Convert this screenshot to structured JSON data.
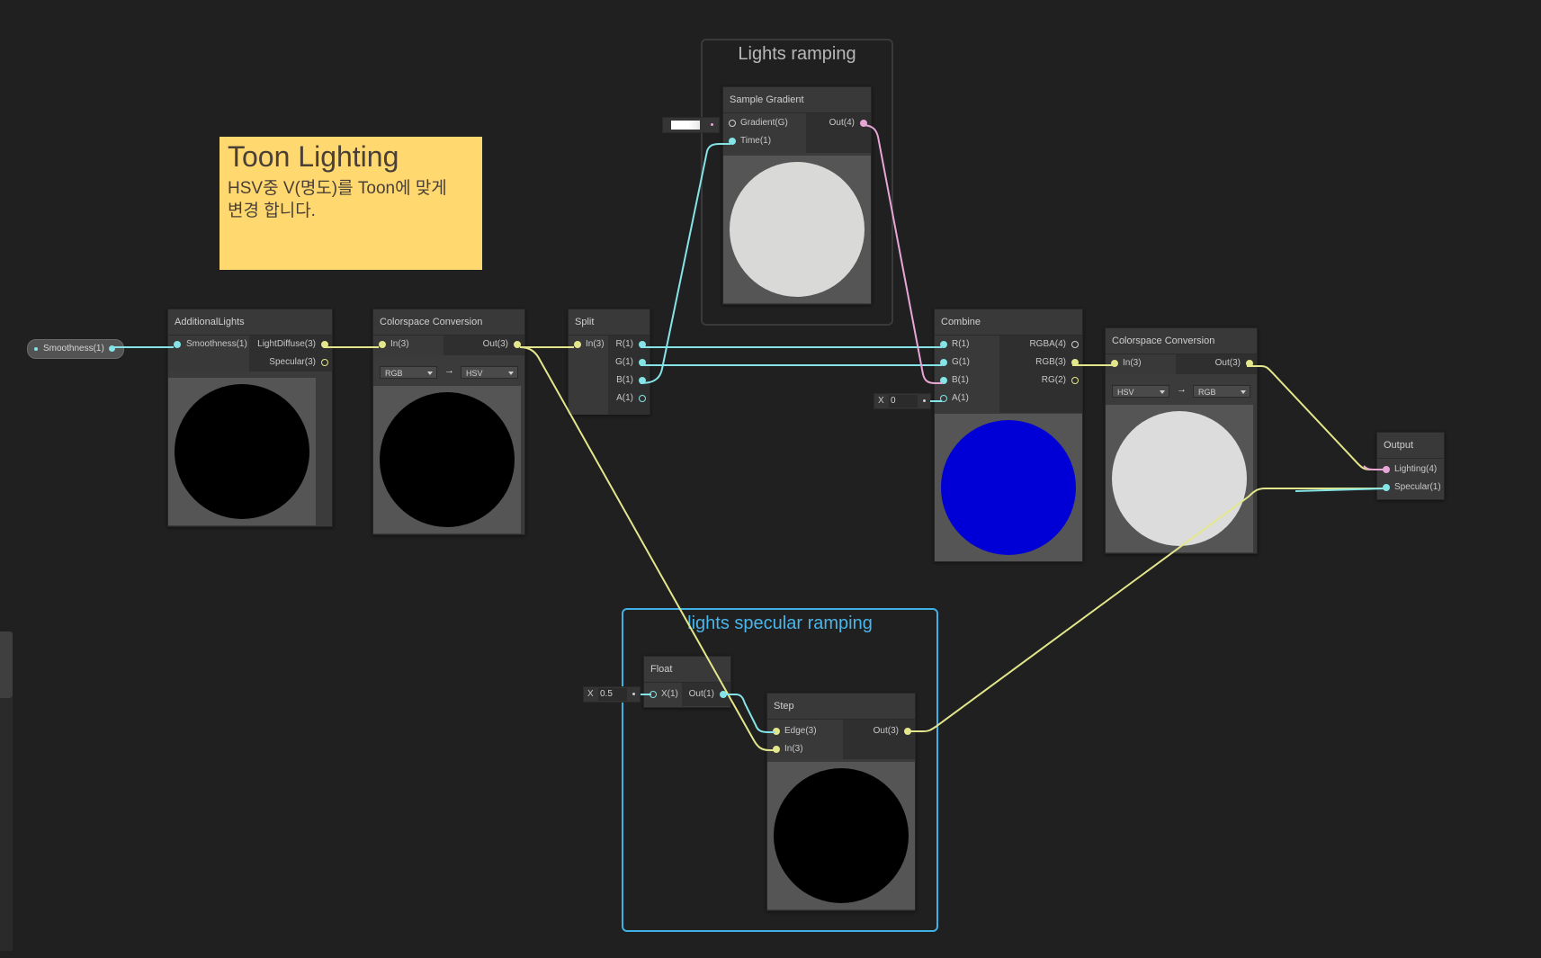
{
  "groups": {
    "lights_ramping": "Lights ramping",
    "lights_specular": "lights specular ramping"
  },
  "sticky": {
    "title": "Toon Lighting",
    "body": "HSV중 V(명도)를 Toon에 맞게\n변경 합니다."
  },
  "property": {
    "label": "Smoothness(1)"
  },
  "nodes": {
    "additional_lights": {
      "title": "AdditionalLights",
      "in": [
        "Smoothness(1)"
      ],
      "out": [
        "LightDiffuse(3)",
        "Specular(3)"
      ]
    },
    "colorspace1": {
      "title": "Colorspace Conversion",
      "in": [
        "In(3)"
      ],
      "out": [
        "Out(3)"
      ],
      "from": "RGB",
      "to": "HSV"
    },
    "split": {
      "title": "Split",
      "in": [
        "In(3)"
      ],
      "out": [
        "R(1)",
        "G(1)",
        "B(1)",
        "A(1)"
      ]
    },
    "sample_gradient": {
      "title": "Sample Gradient",
      "in": [
        "Gradient(G)",
        "Time(1)"
      ],
      "out": [
        "Out(4)"
      ]
    },
    "combine": {
      "title": "Combine",
      "in": [
        "R(1)",
        "G(1)",
        "B(1)",
        "A(1)"
      ],
      "out": [
        "RGBA(4)",
        "RGB(3)",
        "RG(2)"
      ]
    },
    "colorspace2": {
      "title": "Colorspace Conversion",
      "in": [
        "In(3)"
      ],
      "out": [
        "Out(3)"
      ],
      "from": "HSV",
      "to": "RGB"
    },
    "output": {
      "title": "Output",
      "in": [
        "Lighting(4)",
        "Specular(1)"
      ]
    },
    "float": {
      "title": "Float",
      "in": [
        "X(1)"
      ],
      "out": [
        "Out(1)"
      ]
    },
    "step": {
      "title": "Step",
      "in": [
        "Edge(3)",
        "In(3)"
      ],
      "out": [
        "Out(3)"
      ]
    }
  },
  "fields": {
    "combine_a": {
      "axis": "X",
      "value": "0"
    },
    "float_x": {
      "axis": "X",
      "value": "0.5"
    }
  },
  "arrow": "→",
  "colors": {
    "wire_cyan": "#84e4e7",
    "wire_yellow": "#e3e68a",
    "wire_pink": "#e8a6d7",
    "selection": "#3fb1e6",
    "sticky": "#ffd870",
    "preview_blue": "#0000d6",
    "preview_white": "#dcdcdc"
  }
}
